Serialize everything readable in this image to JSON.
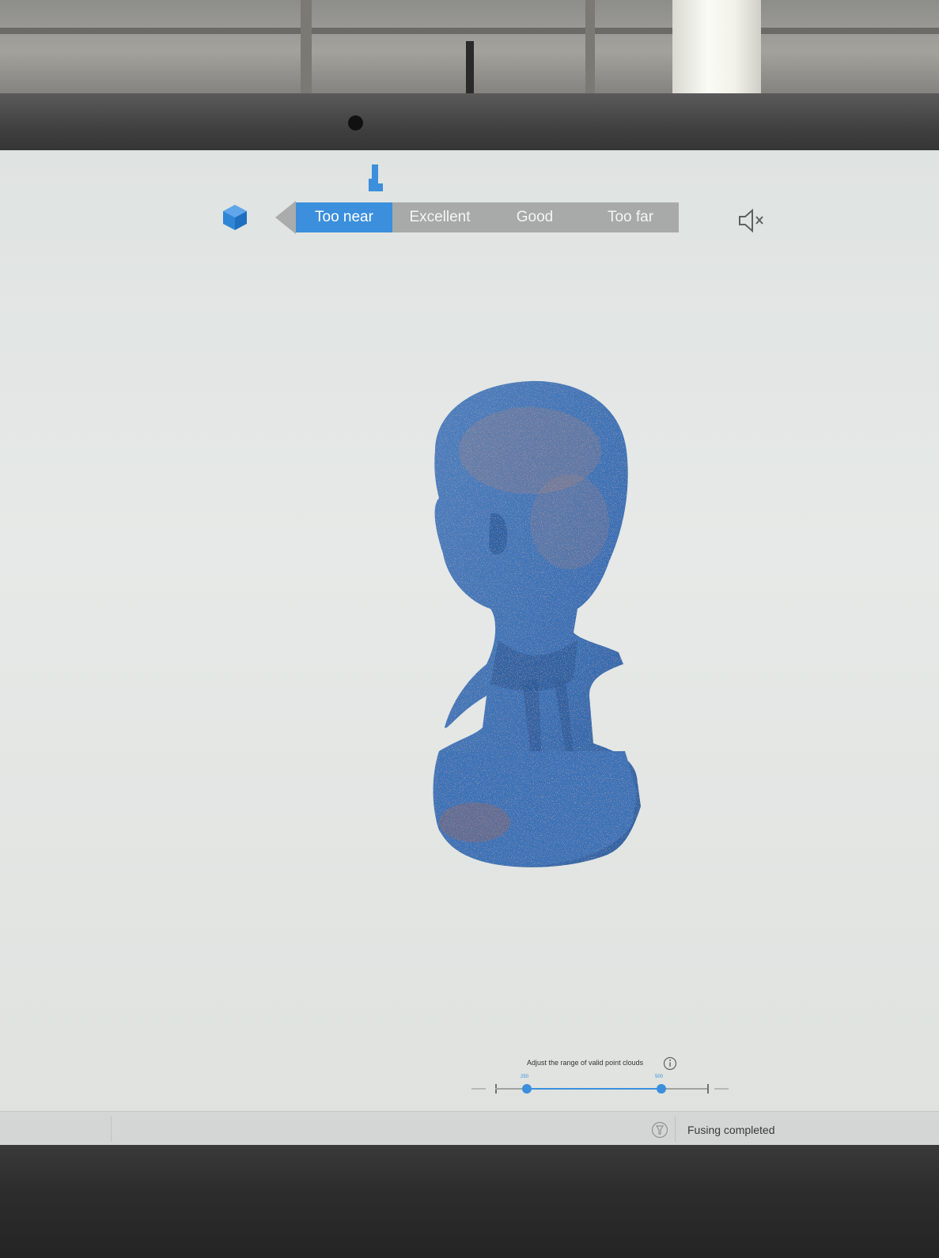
{
  "toolbar": {
    "distance_segments": [
      {
        "label": "Too near",
        "active": true
      },
      {
        "label": "Excellent",
        "active": false
      },
      {
        "label": "Good",
        "active": false
      },
      {
        "label": "Too far",
        "active": false
      }
    ],
    "icons": {
      "view": "cube-icon",
      "position_indicator": "distance-indicator-icon",
      "sound": "speaker-muted-icon"
    }
  },
  "viewport": {
    "object": "point-cloud-bust"
  },
  "range_slider": {
    "label": "Adjust the range of valid point clouds",
    "min_value": "250",
    "max_value": "500"
  },
  "status": {
    "text": "Fusing completed"
  },
  "colors": {
    "accent": "#3b8fdc",
    "segment_inactive": "#a7aaa9",
    "point_cloud_blue": "#3a74b8",
    "point_cloud_orange": "#c98a6e"
  }
}
